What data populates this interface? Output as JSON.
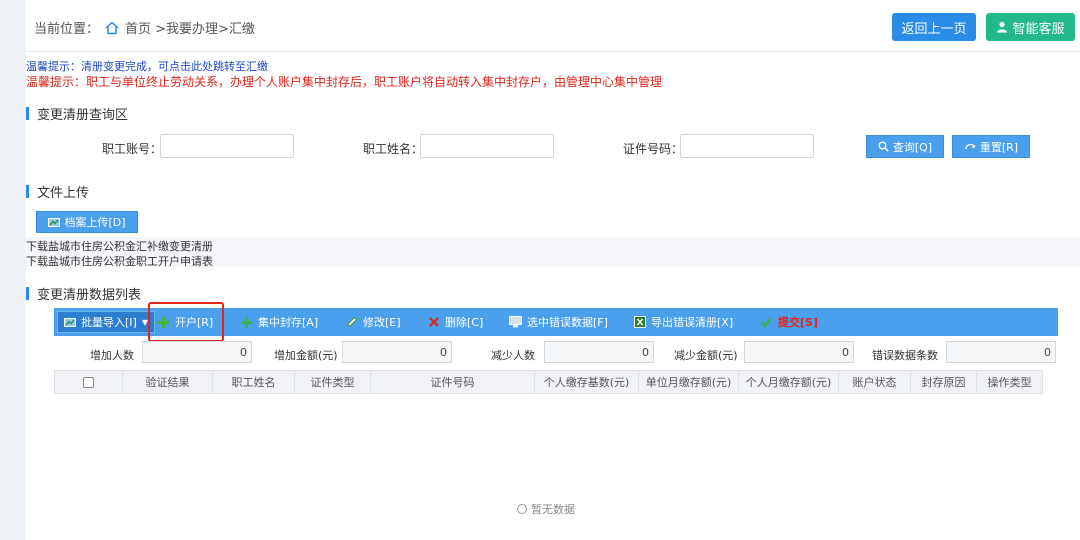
{
  "breadcrumb": {
    "label": "当前位置：",
    "path": "首页 >我要办理>汇缴"
  },
  "header": {
    "back_label": "返回上一页",
    "service_label": "智能客服"
  },
  "tips": {
    "tip1": "温馨提示：清册变更完成，可点击此处跳转至汇缴",
    "tip2": "温馨提示：职工与单位终止劳动关系，办理个人账户集中封存后，职工账户将自动转入集中封存户，由管理中心集中管理"
  },
  "query": {
    "title": "变更清册查询区",
    "account_label": "职工账号：",
    "name_label": "职工姓名：",
    "id_label": "证件号码：",
    "search_label": "查询[Q]",
    "reset_label": "重置[R]"
  },
  "upload": {
    "title": "文件上传",
    "button_label": "档案上传[D]",
    "link1": "下载盐城市住房公积金汇补缴变更清册",
    "link2": "下载盐城市住房公积金职工开户申请表"
  },
  "list": {
    "title": "变更清册数据列表",
    "toolbar": {
      "batch_import": "批量导入[I]",
      "open_account": "开户[R]",
      "central_seal": "集中封存[A]",
      "edit": "修改[E]",
      "delete": "删除[C]",
      "select_errors": "选中错误数据[F]",
      "export_errors": "导出错误清册[X]",
      "submit": "提交[S]"
    },
    "stats": {
      "add_count_label": "增加人数",
      "add_count": "0",
      "add_amount_label": "增加金额(元)",
      "add_amount": "0",
      "reduce_count_label": "减少人数",
      "reduce_count": "0",
      "reduce_amount_label": "减少金额(元)",
      "reduce_amount": "0",
      "error_count_label": "错误数据条数",
      "error_count": "0"
    },
    "columns": [
      "验证结果",
      "职工姓名",
      "证件类型",
      "证件号码",
      "个人缴存基数(元)",
      "单位月缴存额(元)",
      "个人月缴存额(元)",
      "账户状态",
      "封存原因",
      "操作类型"
    ],
    "empty_text": "暂无数据"
  },
  "colors": {
    "primary": "#2a8ce6",
    "toolbar": "#4aa0ec",
    "service": "#23b98a",
    "alert": "#e0261c",
    "tip_blue": "#1d49c4"
  }
}
